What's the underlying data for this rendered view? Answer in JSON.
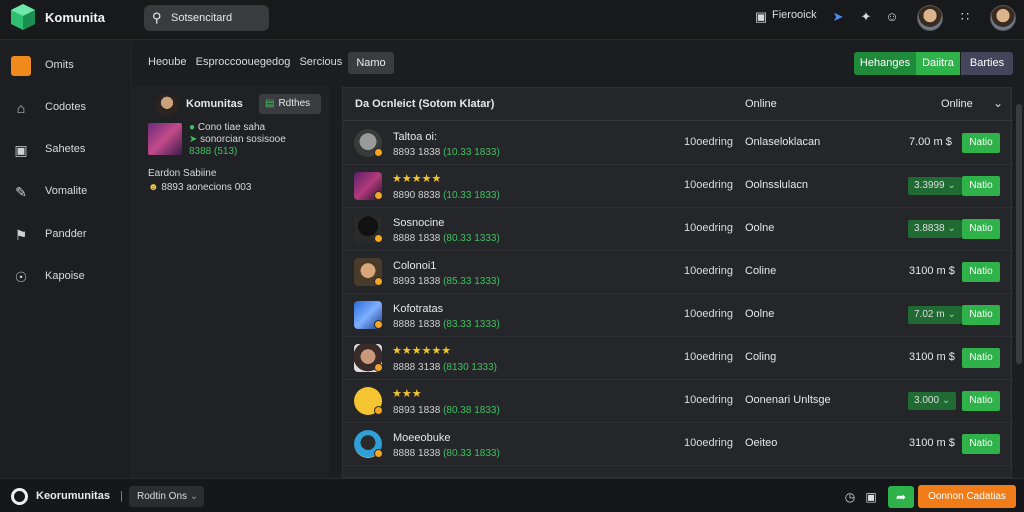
{
  "app": {
    "brand": "Komunita",
    "search_value": "Sotsencitard",
    "top_link": "Fierooick",
    "colors": {
      "accent_green": "#2fb24a",
      "accent_orange": "#f07d1a",
      "background": "#1c1d20"
    }
  },
  "nav": {
    "items": [
      {
        "label": "Omits",
        "icon": "cube-icon"
      },
      {
        "label": "Codotes",
        "icon": "home-icon"
      },
      {
        "label": "Sahetes",
        "icon": "square-icon"
      },
      {
        "label": "Vomalite",
        "icon": "pencil-icon"
      },
      {
        "label": "Pandder",
        "icon": "flag-icon"
      },
      {
        "label": "Kapoise",
        "icon": "info-icon"
      }
    ]
  },
  "toolbar": {
    "crumbs": [
      "Heoube",
      "Esproccoouegedog",
      "Sercious"
    ],
    "name_button": "Namo",
    "segments": [
      "Hehanges",
      "Daiitra",
      "Barties"
    ]
  },
  "panel": {
    "title": "Komunitas",
    "button": "Rdthes",
    "line1": "Cono tiae saha",
    "line2": "sonorcian sosisooe",
    "line3": "8388 (513)",
    "line4": "Eardon Sabiine",
    "line5": "8893 aonecions 003"
  },
  "list": {
    "header_title": "Da Ocnleict (Sotom Klatar)",
    "col_online": "Online",
    "col_online2": "Online",
    "rows": [
      {
        "name": "Taltoa oi:",
        "stars": "",
        "sub1": "8893 1838",
        "sub2": "(10.33 1833)",
        "status": "10oedring",
        "online": "Onlaseloklacan",
        "amount": "7.00 m",
        "amount_pill": false,
        "action": "Natio"
      },
      {
        "name": "",
        "stars": "★★★★★",
        "sub1": "8890 8838",
        "sub2": "(10.33 1833)",
        "status": "10oedring",
        "online": "Oolnsslulacn",
        "amount": "3.3999",
        "amount_pill": true,
        "action": "Natio"
      },
      {
        "name": "Sosnocine",
        "stars": "",
        "sub1": "8888 1838",
        "sub2": "(80.33 1333)",
        "status": "10oedring",
        "online": "Oolne",
        "amount": "3.8838",
        "amount_pill": true,
        "action": "Natio"
      },
      {
        "name": "Colonoi1",
        "stars": "",
        "sub1": "8893 1838",
        "sub2": "(85.33 1333)",
        "status": "10oedring",
        "online": "Coline",
        "amount": "3100 m",
        "amount_pill": false,
        "action": "Natio"
      },
      {
        "name": "Kofotratas",
        "stars": "",
        "sub1": "8888 1838",
        "sub2": "(83.33 1333)",
        "status": "10oedring",
        "online": "Oolne",
        "amount": "7.02 m",
        "amount_pill": true,
        "action": "Natio"
      },
      {
        "name": "",
        "stars": "★★★★★★",
        "sub1": "8888 3138",
        "sub2": "(8130 1333)",
        "status": "10oedring",
        "online": "Coling",
        "amount": "3100 m",
        "amount_pill": false,
        "action": "Natio"
      },
      {
        "name": "",
        "stars": "★★★",
        "sub1": "8893 1838",
        "sub2": "(80.38 1833)",
        "status": "10oedring",
        "online": "Oonenari Unltsge",
        "amount": "3.000",
        "amount_pill": true,
        "action": "Natio"
      },
      {
        "name": "Moeeobuke",
        "stars": "",
        "sub1": "8888 1838",
        "sub2": "(80.33 1833)",
        "status": "10oedring",
        "online": "Oeiteo",
        "amount": "3100 m",
        "amount_pill": false,
        "action": "Natio"
      }
    ]
  },
  "bottom": {
    "brand": "Keorumunitas",
    "separator": "|",
    "dropdown": "Rodtin Ons",
    "primary_button": "Oonnon Cadatias"
  }
}
